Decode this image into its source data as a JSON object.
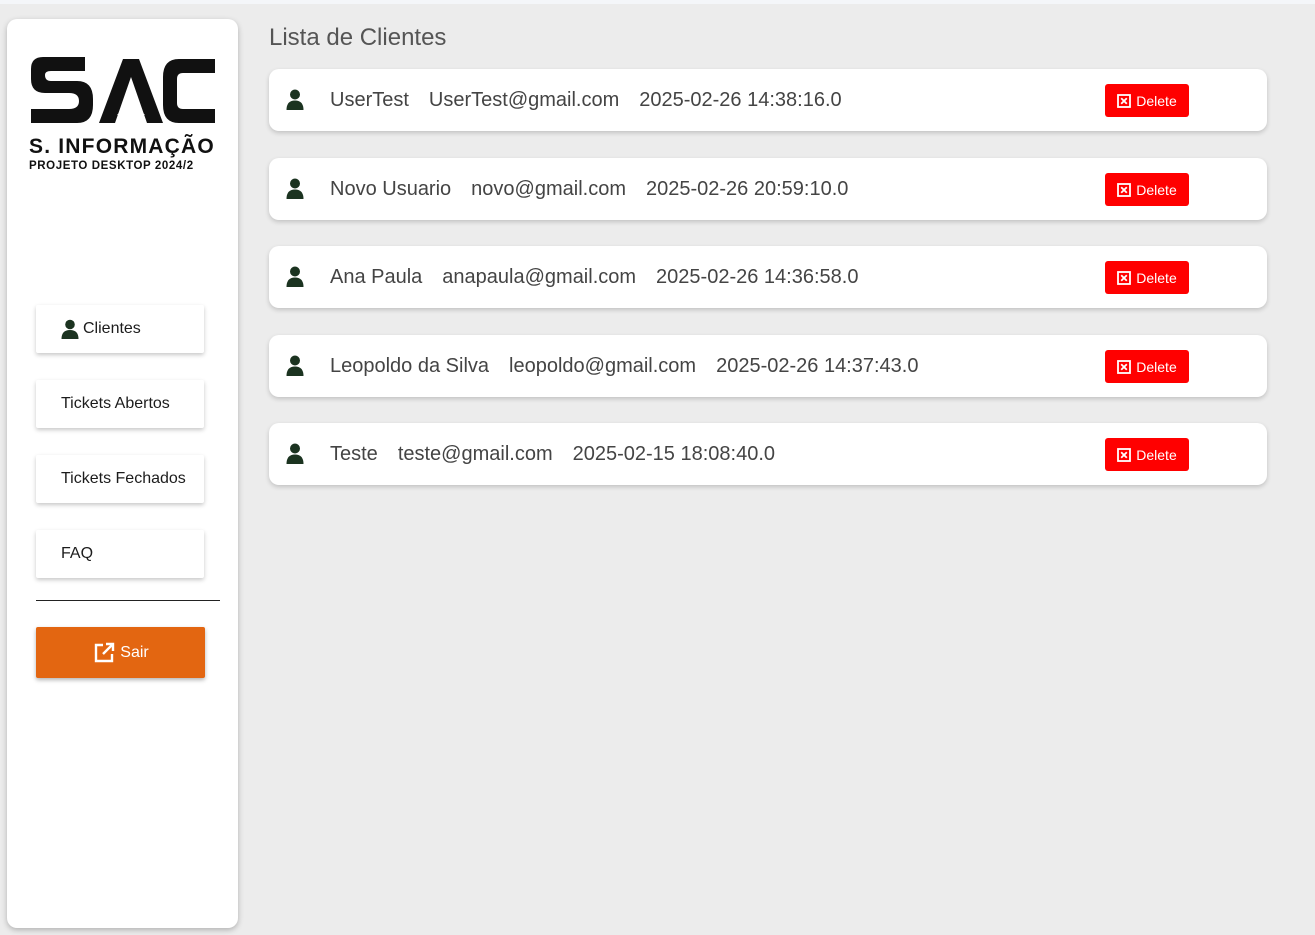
{
  "sidebar": {
    "logo": {
      "mark": "SAC",
      "title": "S. INFORMAÇÃO",
      "subtitle": "PROJETO DESKTOP 2024/2"
    },
    "nav": [
      {
        "label": "Clientes",
        "icon": "user-icon"
      },
      {
        "label": "Tickets Abertos"
      },
      {
        "label": "Tickets Fechados"
      },
      {
        "label": "FAQ"
      }
    ],
    "logout": {
      "label": "Sair",
      "icon": "external-link-icon"
    }
  },
  "main": {
    "title": "Lista de Clientes",
    "clients": [
      {
        "name": "UserTest",
        "email": "UserTest@gmail.com",
        "created": "2025-02-26 14:38:16.0"
      },
      {
        "name": "Novo Usuario",
        "email": "novo@gmail.com",
        "created": "2025-02-26 20:59:10.0"
      },
      {
        "name": "Ana Paula",
        "email": "anapaula@gmail.com",
        "created": "2025-02-26 14:36:58.0"
      },
      {
        "name": "Leopoldo da Silva",
        "email": "leopoldo@gmail.com",
        "created": "2025-02-26 14:37:43.0"
      },
      {
        "name": "Teste",
        "email": "teste@gmail.com",
        "created": "2025-02-15 18:08:40.0"
      }
    ],
    "delete_label": "Delete"
  },
  "colors": {
    "accent_orange": "#e36611",
    "delete_red": "#ff0000",
    "user_icon_green": "#1b3320",
    "background": "#ececec"
  }
}
